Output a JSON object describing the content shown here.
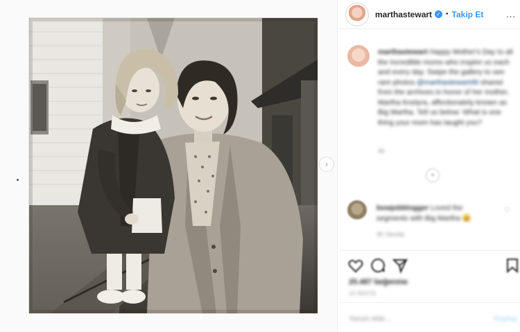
{
  "header": {
    "username": "marthastewart",
    "separator": "•",
    "follow_label": "Takip Et",
    "more_label": "..."
  },
  "caption": {
    "username": "marthastewart",
    "text": "Happy Mother's Day to all the incredible moms who inspire us each and every day. Swipe the gallery to see rare photos",
    "mention": "@marthastewart48",
    "text2": "shared from the archives in honor of her mother, Martha Kostyra, affectionately known as Big Martha. Tell us below: What is one thing your mom has taught you?",
    "time": "4h"
  },
  "comment": {
    "username": "bowjobblogger",
    "text": "Loved the segments with Big Martha 😀",
    "meta": "4h   Yanıtla"
  },
  "stats": {
    "likes": "25.487 beğenme",
    "date": "10 MAYIS"
  },
  "add_comment": {
    "placeholder": "Yorum ekle...",
    "post_label": "Paylaş"
  },
  "icons": {
    "verified": "verified-badge-icon",
    "like": "heart-icon",
    "comment": "comment-icon",
    "share": "share-icon",
    "save": "bookmark-icon",
    "next": "chevron-right-icon"
  },
  "colors": {
    "accent": "#3897f0",
    "text": "#262626",
    "muted": "#8e8e8e"
  }
}
